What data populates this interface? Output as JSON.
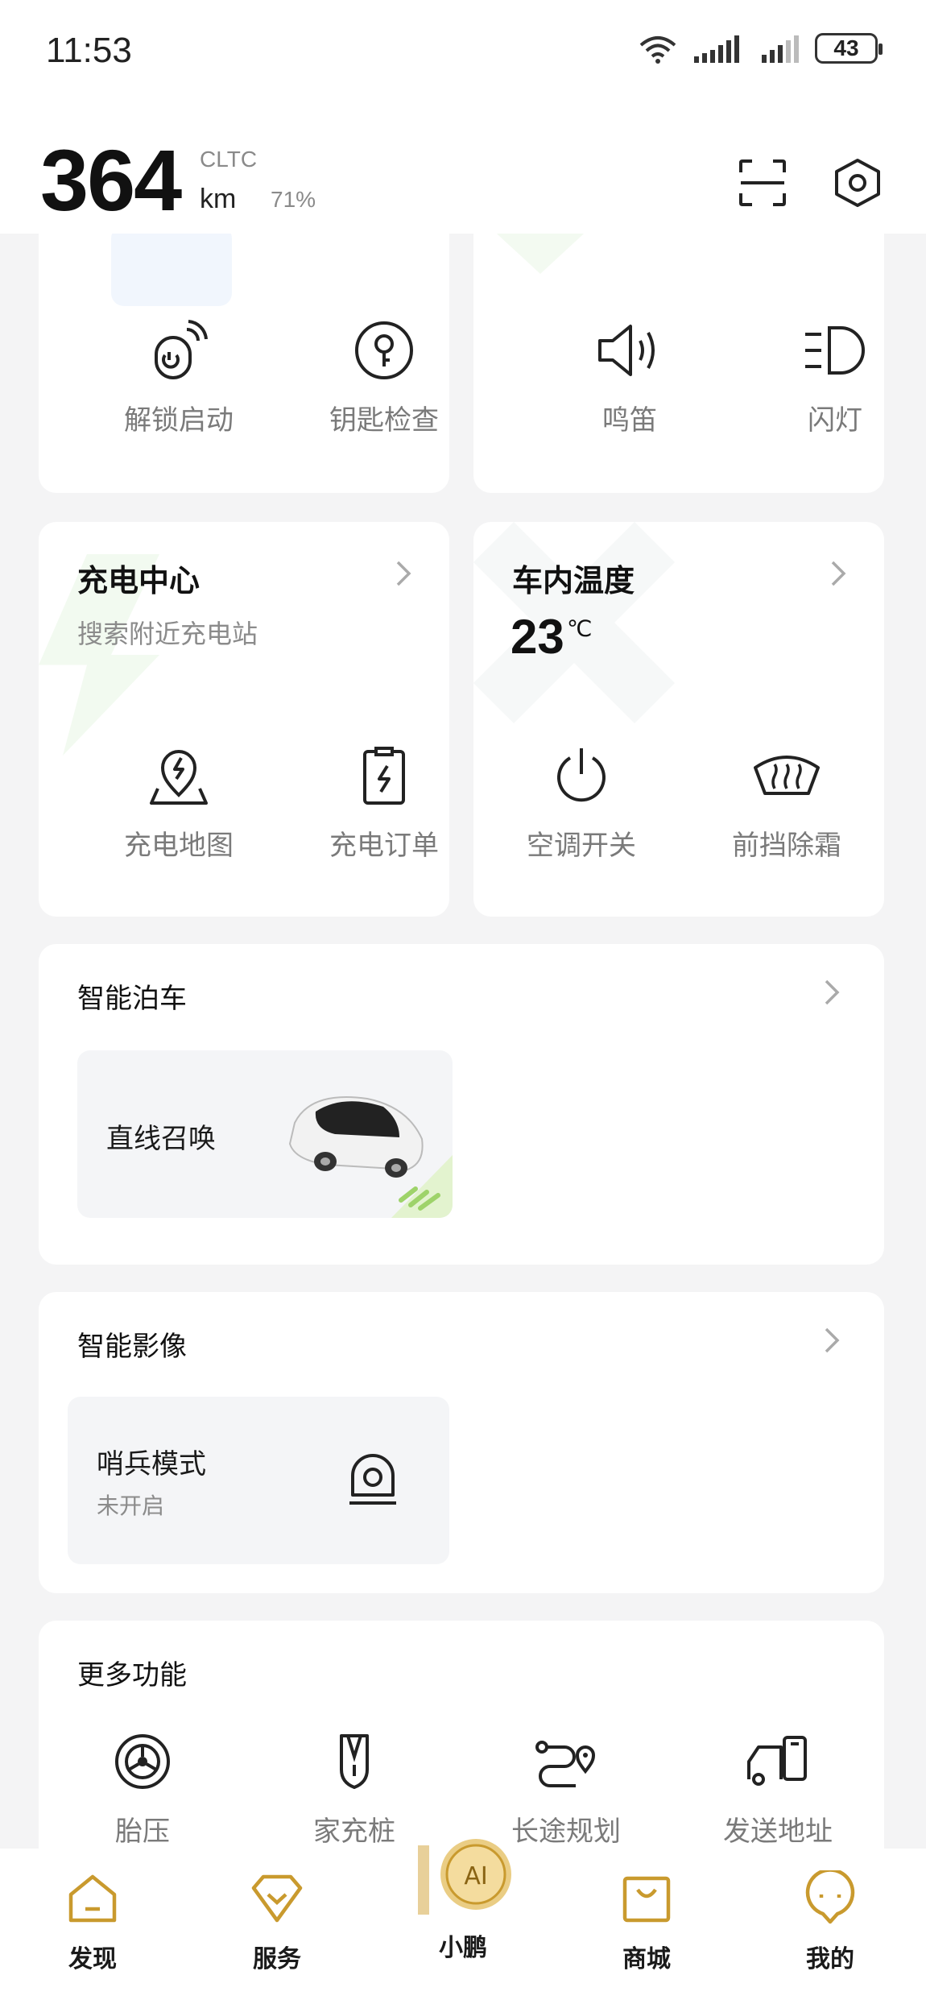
{
  "status_bar": {
    "time": "11:53",
    "battery": "43"
  },
  "header": {
    "range": "364",
    "range_standard": "CLTC",
    "range_unit": "km",
    "battery_percent": "71%"
  },
  "quick_actions": {
    "left": [
      {
        "label": "解锁启动",
        "icon": "remote-key-icon"
      },
      {
        "label": "钥匙检查",
        "icon": "key-icon"
      }
    ],
    "right": [
      {
        "label": "鸣笛",
        "icon": "horn-icon"
      },
      {
        "label": "闪灯",
        "icon": "headlight-icon"
      }
    ]
  },
  "charging_center": {
    "title": "充电中心",
    "subtitle": "搜索附近充电站",
    "actions": [
      {
        "label": "充电地图",
        "icon": "charge-map-icon"
      },
      {
        "label": "充电订单",
        "icon": "charge-order-icon"
      }
    ]
  },
  "cabin_temp": {
    "title": "车内温度",
    "value": "23",
    "unit": "℃",
    "actions": [
      {
        "label": "空调开关",
        "icon": "power-icon"
      },
      {
        "label": "前挡除霜",
        "icon": "defrost-icon"
      }
    ]
  },
  "smart_parking": {
    "title": "智能泊车",
    "tile_label": "直线召唤"
  },
  "smart_imaging": {
    "title": "智能影像",
    "tile_label": "哨兵模式",
    "tile_status": "未开启"
  },
  "more_features": {
    "title": "更多功能",
    "items": [
      {
        "label": "胎压",
        "icon": "tire-icon"
      },
      {
        "label": "家充桩",
        "icon": "home-charger-icon"
      },
      {
        "label": "长途规划",
        "icon": "route-icon"
      },
      {
        "label": "发送地址",
        "icon": "send-address-icon"
      }
    ]
  },
  "bottom_nav": {
    "items": [
      {
        "label": "发现",
        "icon": "home-icon"
      },
      {
        "label": "服务",
        "icon": "service-icon"
      },
      {
        "label": "小鹏",
        "icon": "ai-assistant-icon",
        "badge": "AI"
      },
      {
        "label": "商城",
        "icon": "shop-icon"
      },
      {
        "label": "我的",
        "icon": "profile-icon"
      }
    ]
  },
  "colors": {
    "accent_gold": "#c99a2e",
    "accent_green": "#9ed36a",
    "text_muted": "#7a7a7a"
  }
}
